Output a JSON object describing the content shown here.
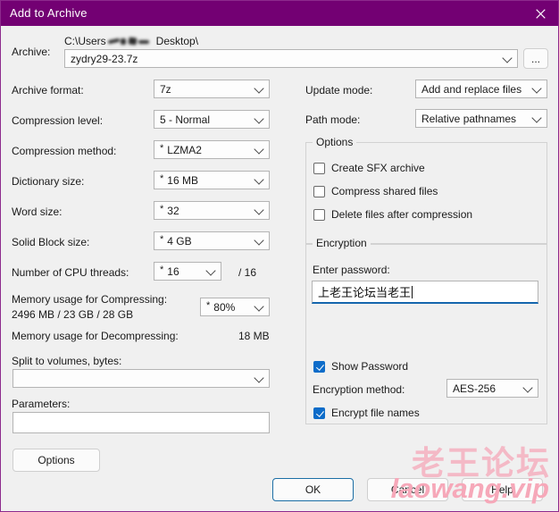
{
  "window": {
    "title": "Add to Archive",
    "close_icon": "close-icon",
    "accent_titlebar": "#730073",
    "accent_focus": "#1566ad",
    "accent_checkbox": "#0d6cc9"
  },
  "archive": {
    "label": "Archive:",
    "path_prefix": "C:\\Users",
    "path_suffix": "Desktop\\",
    "name_value": "zydry29-23.7z",
    "browse_label": "..."
  },
  "left": {
    "archive_format": {
      "label": "Archive format:",
      "value": "7z",
      "star": false
    },
    "compression_level": {
      "label": "Compression level:",
      "value": "5 - Normal",
      "star": false
    },
    "compression_method": {
      "label": "Compression method:",
      "value": "LZMA2",
      "star": true
    },
    "dictionary_size": {
      "label": "Dictionary size:",
      "value": "16 MB",
      "star": true
    },
    "word_size": {
      "label": "Word size:",
      "value": "32",
      "star": true
    },
    "solid_block_size": {
      "label": "Solid Block size:",
      "value": "4 GB",
      "star": true
    },
    "cpu_threads": {
      "label": "Number of CPU threads:",
      "value": "16",
      "star": true,
      "total": "/ 16"
    },
    "mem_compress": {
      "label": "Memory usage for Compressing:",
      "detail": "2496 MB / 23 GB / 28 GB",
      "percent_value": "80%",
      "star": true
    },
    "mem_decompress": {
      "label": "Memory usage for Decompressing:",
      "value": "18 MB"
    },
    "split_volumes": {
      "label": "Split to volumes, bytes:",
      "value": ""
    },
    "parameters": {
      "label": "Parameters:",
      "value": ""
    }
  },
  "right": {
    "update_mode": {
      "label": "Update mode:",
      "value": "Add and replace files"
    },
    "path_mode": {
      "label": "Path mode:",
      "value": "Relative pathnames"
    },
    "options_group": {
      "title": "Options",
      "items": [
        {
          "label": "Create SFX archive",
          "checked": false
        },
        {
          "label": "Compress shared files",
          "checked": false
        },
        {
          "label": "Delete files after compression",
          "checked": false
        }
      ]
    },
    "encryption_group": {
      "title": "Encryption",
      "password_label": "Enter password:",
      "password_value": "上老王论坛当老王",
      "show_password": {
        "label": "Show Password",
        "checked": true
      },
      "method_label": "Encryption method:",
      "method_value": "AES-256",
      "encrypt_names": {
        "label": "Encrypt file names",
        "checked": true
      }
    }
  },
  "footer": {
    "options_label": "Options",
    "ok_label": "OK",
    "cancel_label": "Cancel",
    "help_label": "Help"
  },
  "watermark": {
    "line1": "老王论坛",
    "line2": "laowang.vip"
  }
}
